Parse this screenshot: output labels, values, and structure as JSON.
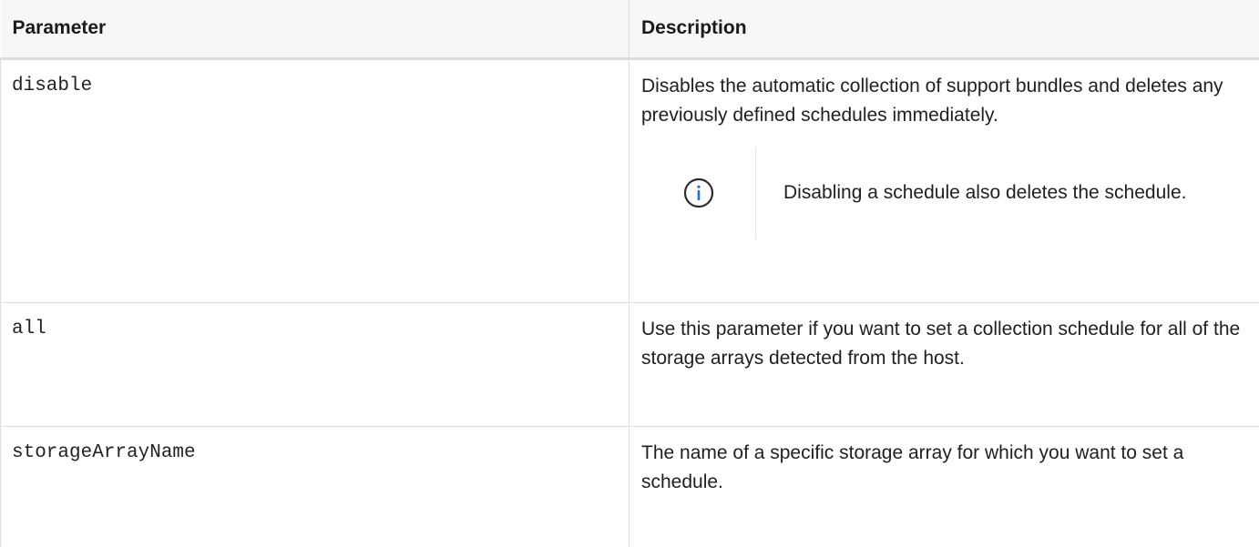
{
  "table": {
    "headers": {
      "parameter": "Parameter",
      "description": "Description"
    },
    "rows": [
      {
        "parameter": "disable",
        "description": "Disables the automatic collection of support bundles and deletes any previously defined schedules immediately.",
        "note": "Disabling a schedule also deletes the schedule."
      },
      {
        "parameter": "all",
        "description": "Use this parameter if you want to set a collection schedule for all of the storage arrays detected from the host."
      },
      {
        "parameter": "storageArrayName",
        "description": "The name of a specific storage array for which you want to set a schedule."
      }
    ]
  },
  "icons": {
    "note_icon": "info-circle-icon"
  },
  "colors": {
    "header_bg": "#f7f7f7",
    "border": "#dddddd",
    "text": "#1a1a1a",
    "info_icon_stroke": "#2d2d2d",
    "info_icon_glyph": "#1e6fd9"
  }
}
